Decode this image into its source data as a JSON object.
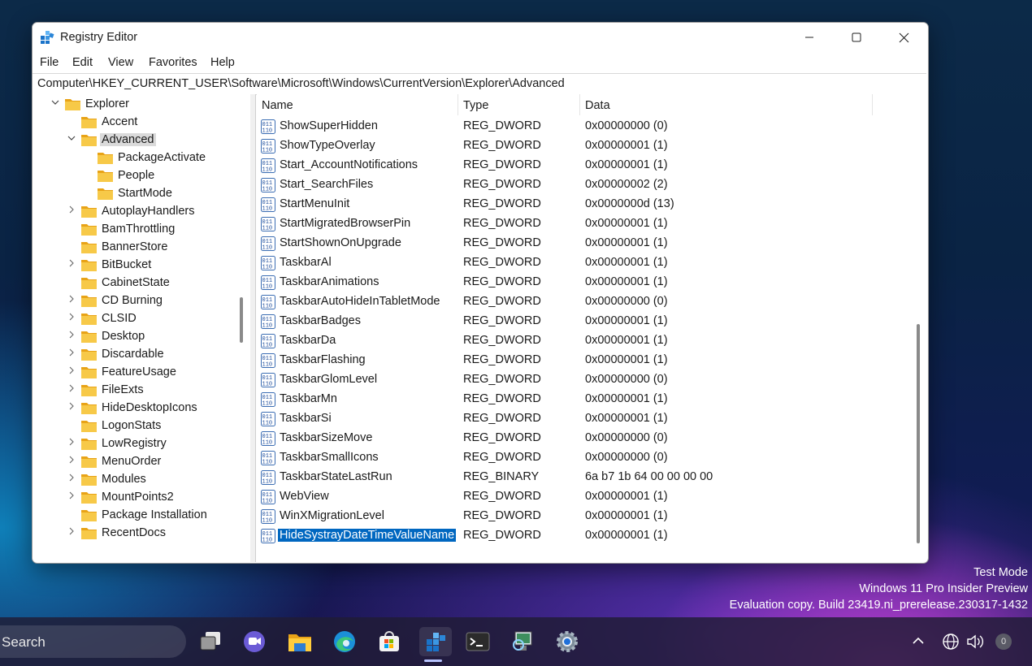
{
  "window": {
    "title": "Registry Editor",
    "menu": [
      "File",
      "Edit",
      "View",
      "Favorites",
      "Help"
    ],
    "address": "Computer\\HKEY_CURRENT_USER\\Software\\Microsoft\\Windows\\CurrentVersion\\Explorer\\Advanced"
  },
  "tree": {
    "items": [
      {
        "label": "Explorer",
        "chevron": "expanded"
      },
      {
        "label": "Accent",
        "chevron": "none"
      },
      {
        "label": "Advanced",
        "chevron": "expanded",
        "selected": true
      },
      {
        "label": "PackageActivate",
        "chevron": "none"
      },
      {
        "label": "People",
        "chevron": "none"
      },
      {
        "label": "StartMode",
        "chevron": "none"
      },
      {
        "label": "AutoplayHandlers",
        "chevron": "collapsed"
      },
      {
        "label": "BamThrottling",
        "chevron": "none"
      },
      {
        "label": "BannerStore",
        "chevron": "none"
      },
      {
        "label": "BitBucket",
        "chevron": "collapsed"
      },
      {
        "label": "CabinetState",
        "chevron": "none"
      },
      {
        "label": "CD Burning",
        "chevron": "collapsed"
      },
      {
        "label": "CLSID",
        "chevron": "collapsed"
      },
      {
        "label": "Desktop",
        "chevron": "collapsed"
      },
      {
        "label": "Discardable",
        "chevron": "collapsed"
      },
      {
        "label": "FeatureUsage",
        "chevron": "collapsed"
      },
      {
        "label": "FileExts",
        "chevron": "collapsed"
      },
      {
        "label": "HideDesktopIcons",
        "chevron": "collapsed"
      },
      {
        "label": "LogonStats",
        "chevron": "none"
      },
      {
        "label": "LowRegistry",
        "chevron": "collapsed"
      },
      {
        "label": "MenuOrder",
        "chevron": "collapsed"
      },
      {
        "label": "Modules",
        "chevron": "collapsed"
      },
      {
        "label": "MountPoints2",
        "chevron": "collapsed"
      },
      {
        "label": "Package Installation",
        "chevron": "none"
      },
      {
        "label": "RecentDocs",
        "chevron": "collapsed"
      }
    ]
  },
  "list": {
    "columns": {
      "name": "Name",
      "type": "Type",
      "data": "Data"
    },
    "rows": [
      {
        "name": "ShowSuperHidden",
        "type": "REG_DWORD",
        "data": "0x00000000 (0)"
      },
      {
        "name": "ShowTypeOverlay",
        "type": "REG_DWORD",
        "data": "0x00000001 (1)"
      },
      {
        "name": "Start_AccountNotifications",
        "type": "REG_DWORD",
        "data": "0x00000001 (1)"
      },
      {
        "name": "Start_SearchFiles",
        "type": "REG_DWORD",
        "data": "0x00000002 (2)"
      },
      {
        "name": "StartMenuInit",
        "type": "REG_DWORD",
        "data": "0x0000000d (13)"
      },
      {
        "name": "StartMigratedBrowserPin",
        "type": "REG_DWORD",
        "data": "0x00000001 (1)"
      },
      {
        "name": "StartShownOnUpgrade",
        "type": "REG_DWORD",
        "data": "0x00000001 (1)"
      },
      {
        "name": "TaskbarAl",
        "type": "REG_DWORD",
        "data": "0x00000001 (1)"
      },
      {
        "name": "TaskbarAnimations",
        "type": "REG_DWORD",
        "data": "0x00000001 (1)"
      },
      {
        "name": "TaskbarAutoHideInTabletMode",
        "type": "REG_DWORD",
        "data": "0x00000000 (0)"
      },
      {
        "name": "TaskbarBadges",
        "type": "REG_DWORD",
        "data": "0x00000001 (1)"
      },
      {
        "name": "TaskbarDa",
        "type": "REG_DWORD",
        "data": "0x00000001 (1)"
      },
      {
        "name": "TaskbarFlashing",
        "type": "REG_DWORD",
        "data": "0x00000001 (1)"
      },
      {
        "name": "TaskbarGlomLevel",
        "type": "REG_DWORD",
        "data": "0x00000000 (0)"
      },
      {
        "name": "TaskbarMn",
        "type": "REG_DWORD",
        "data": "0x00000001 (1)"
      },
      {
        "name": "TaskbarSi",
        "type": "REG_DWORD",
        "data": "0x00000001 (1)"
      },
      {
        "name": "TaskbarSizeMove",
        "type": "REG_DWORD",
        "data": "0x00000000 (0)"
      },
      {
        "name": "TaskbarSmallIcons",
        "type": "REG_DWORD",
        "data": "0x00000000 (0)"
      },
      {
        "name": "TaskbarStateLastRun",
        "type": "REG_BINARY",
        "data": "6a b7 1b 64 00 00 00 00"
      },
      {
        "name": "WebView",
        "type": "REG_DWORD",
        "data": "0x00000001 (1)"
      },
      {
        "name": "WinXMigrationLevel",
        "type": "REG_DWORD",
        "data": "0x00000001 (1)"
      },
      {
        "name": "HideSystrayDateTimeValueName",
        "type": "REG_DWORD",
        "data": "0x00000001 (1)",
        "selected": true
      }
    ]
  },
  "watermark": {
    "line1": "Test Mode",
    "line2": "Windows 11 Pro Insider Preview",
    "line3": "Evaluation copy. Build 23419.ni_prerelease.230317-1432"
  },
  "taskbar": {
    "search_placeholder": "Search",
    "apps": [
      "task-view-icon",
      "chat-icon",
      "file-explorer-icon",
      "edge-icon",
      "store-icon",
      "registry-editor-icon",
      "terminal-icon",
      "device-manager-icon",
      "settings-icon"
    ],
    "notification_count": "0"
  },
  "colors": {
    "selection": "#0067c0",
    "folder": "#f5c542",
    "accent": "#0067c0"
  }
}
